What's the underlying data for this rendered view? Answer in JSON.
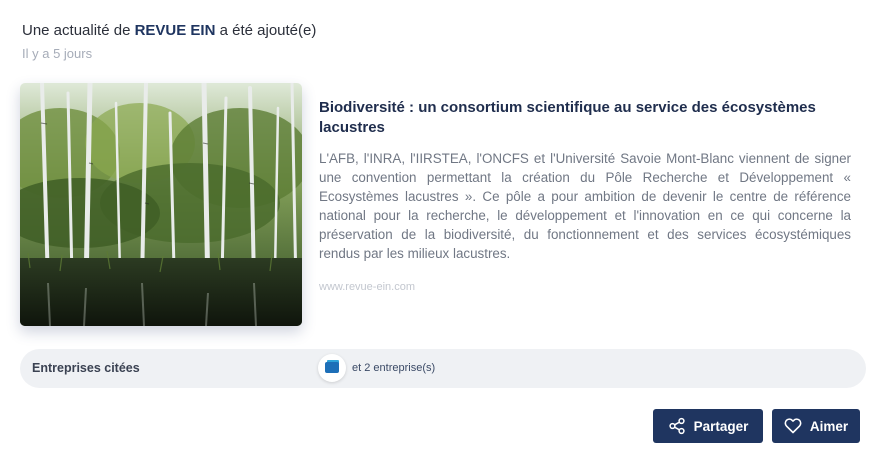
{
  "notification": {
    "prefix": "Une actualité de",
    "brand": "REVUE EIN",
    "suffix": "a été ajouté(e)",
    "time_ago": "Il y a 5 jours"
  },
  "article": {
    "title": "Biodiversité : un consortium scientifique au service des écosystèmes lacustres",
    "body": "L'AFB, l'INRA, l'IIRSTEA, l'ONCFS et l'Université Savoie Mont-Blanc viennent de signer une convention permettant la création du Pôle Recherche et Développement « Ecosystèmes lacustres ». Ce pôle a pour ambition de devenir le centre de référence national pour la recherche, le développement et l'innovation en ce qui concerne la préservation de la biodiversité, du fonctionnement et des services écosystémiques rendus par les milieux lacustres.",
    "source": "www.revue-ein.com",
    "image_alt": "forest-lake-photo"
  },
  "companies": {
    "label": "Entreprises citées",
    "more": "et 2 entreprise(s)"
  },
  "actions": {
    "share_label": "Partager",
    "like_label": "Aimer"
  },
  "colors": {
    "primary": "#1f3560",
    "muted": "#a6acb8",
    "pill_bg": "#eff1f4"
  },
  "icons": {
    "share": "share-icon",
    "like": "heart-icon",
    "company_logo": "company-logo-icon"
  }
}
